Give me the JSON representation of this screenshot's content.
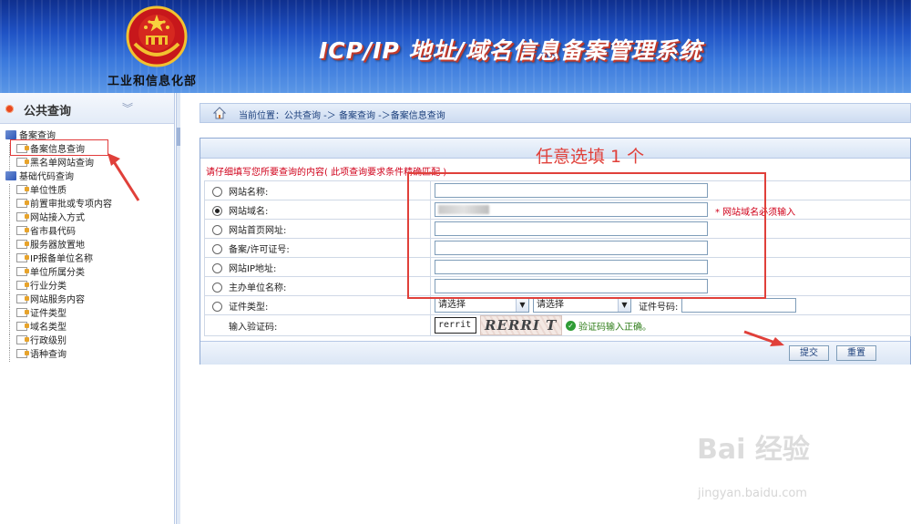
{
  "header": {
    "ministry": "工业和信息化部",
    "system_title": "ICP/IP 地址/域名信息备案管理系统"
  },
  "sidebar": {
    "title": "公共查询",
    "groups": [
      {
        "label": "备案查询",
        "items": [
          "备案信息查询",
          "黑名单网站查询"
        ]
      },
      {
        "label": "基础代码查询",
        "items": [
          "单位性质",
          "前置审批或专项内容",
          "网站接入方式",
          "省市县代码",
          "服务器放置地",
          "IP报备单位名称",
          "单位所属分类",
          "行业分类",
          "网站服务内容",
          "证件类型",
          "域名类型",
          "行政级别",
          "语种查询"
        ]
      }
    ]
  },
  "breadcrumb": {
    "text": "当前位置：公共查询  -＞  备案查询  -＞备案信息查询"
  },
  "form": {
    "note": "请仔细填写您所要查询的内容( 此项查询要求条件精确匹配 )",
    "fields": [
      {
        "label": "网站名称:",
        "selected": false,
        "value": ""
      },
      {
        "label": "网站域名:",
        "selected": true,
        "value": ""
      },
      {
        "label": "网站首页网址:",
        "selected": false,
        "value": ""
      },
      {
        "label": "备案/许可证号:",
        "selected": false,
        "value": ""
      },
      {
        "label": "网站IP地址:",
        "selected": false,
        "value": ""
      },
      {
        "label": "主办单位名称:",
        "selected": false,
        "value": ""
      }
    ],
    "domain_required": "* 网站域名必须输入",
    "cert_type_label": "证件类型:",
    "select1": "请选择",
    "select2": "请选择",
    "cert_number_label": "证件号码:",
    "captcha_label": "输入验证码:",
    "captcha_value": "rerrit",
    "captcha_image_text": "RERRI T",
    "captcha_ok": "验证码输入正确。",
    "submit": "提交",
    "reset": "重置"
  },
  "annotation": {
    "text": "任意选填 1 个",
    "color": "#e0403a"
  },
  "watermark": {
    "brand": "Bai 经验",
    "url": "jingyan.baidu.com"
  }
}
